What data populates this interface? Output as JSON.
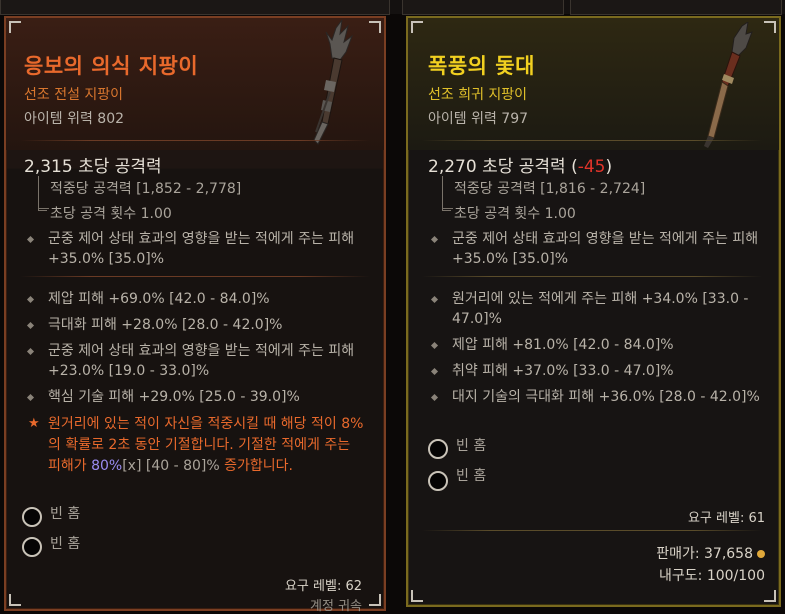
{
  "left_item": {
    "name": "응보의 의식 지팡이",
    "rarity_line": "선조 전설 지팡이",
    "item_power": "아이템 위력 802",
    "dps_line": "2,315 초당 공격력",
    "damage_per_hit": "적중당 공격력 [1,852 - 2,778]",
    "attacks_per_second": "초당 공격 횟수 1.00",
    "implicit_affix": "군중 제어 상태 효과의 영향을 받는 적에게 주는 피해 +35.0% [35.0]%",
    "affixes": [
      "제압 피해 +69.0% [42.0 - 84.0]%",
      "극대화 피해 +28.0% [28.0 - 42.0]%",
      "군중 제어 상태 효과의 영향을 받는 적에게 주는 피해 +23.0% [19.0 - 33.0]%",
      "핵심 기술 피해 +29.0% [25.0 - 39.0]%"
    ],
    "legendary_prefix": "원거리에 있는 적이 자신을 적중시킬 때 해당 적이 8%의 확률로 2초 동안 기절합니다. 기절한 적에게 주는 피해가",
    "legendary_value": "80%",
    "legendary_range": "[x] [40 - 80]%",
    "legendary_suffix": "증가합니다.",
    "sockets": [
      "빈 홈",
      "빈 홈"
    ],
    "required_level": "요구 레벨: 62",
    "account_bound": "계정 귀속",
    "colors": {
      "name": "#e8692c",
      "border": "#7a3e22"
    }
  },
  "right_item": {
    "name": "폭풍의 돛대",
    "rarity_line": "선조 희귀 지팡이",
    "item_power": "아이템 위력 797",
    "dps_line": "2,270 초당 공격력",
    "dps_diff": "-45",
    "damage_per_hit": "적중당 공격력 [1,816 - 2,724]",
    "attacks_per_second": "초당 공격 횟수 1.00",
    "implicit_affix": "군중 제어 상태 효과의 영향을 받는 적에게 주는 피해 +35.0% [35.0]%",
    "affixes": [
      "원거리에 있는 적에게 주는 피해 +34.0% [33.0 - 47.0]%",
      "제압 피해 +81.0% [42.0 - 84.0]%",
      "취약 피해 +37.0% [33.0 - 47.0]%",
      "대지 기술의 극대화 피해 +36.0% [28.0 - 42.0]%"
    ],
    "sockets": [
      "빈 홈",
      "빈 홈"
    ],
    "required_level": "요구 레벨: 61",
    "sell_value": "판매가: 37,658",
    "durability": "내구도: 100/100",
    "colors": {
      "name": "#f1d020",
      "border": "#7a6a1e"
    }
  }
}
